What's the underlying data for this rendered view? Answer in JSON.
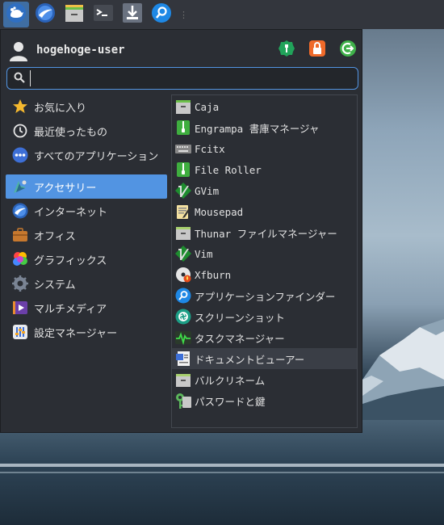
{
  "colors": {
    "accent": "#5294e2",
    "panel": "#33363d",
    "menu_bg": "#2b2e34"
  },
  "panel": {
    "items": [
      {
        "icon": "xfce-mouse-icon",
        "active": true
      },
      {
        "icon": "web-browser-icon"
      },
      {
        "icon": "file-manager-icon"
      },
      {
        "icon": "terminal-icon"
      },
      {
        "icon": "downloads-icon"
      },
      {
        "icon": "app-finder-icon"
      }
    ]
  },
  "menu": {
    "username": "hogehoge-user",
    "search": {
      "value": "",
      "placeholder": ""
    },
    "actions": [
      "settings-icon",
      "lock-screen-icon",
      "log-out-icon"
    ],
    "categories_top": [
      {
        "label": "お気に入り",
        "icon": "star-icon"
      },
      {
        "label": "最近使ったもの",
        "icon": "clock-icon"
      },
      {
        "label": "すべてのアプリケーション",
        "icon": "all-apps-icon"
      }
    ],
    "categories": [
      {
        "label": "アクセサリー",
        "icon": "accessories-icon",
        "selected": true
      },
      {
        "label": "インターネット",
        "icon": "internet-icon"
      },
      {
        "label": "オフィス",
        "icon": "office-icon"
      },
      {
        "label": "グラフィックス",
        "icon": "graphics-icon"
      },
      {
        "label": "システム",
        "icon": "system-icon"
      },
      {
        "label": "マルチメディア",
        "icon": "multimedia-icon"
      },
      {
        "label": "設定マネージャー",
        "icon": "settings-manager-icon"
      }
    ],
    "apps": [
      {
        "label": "Caja",
        "icon": "caja-icon"
      },
      {
        "label": "Engrampa 書庫マネージャ",
        "icon": "archive-icon"
      },
      {
        "label": "Fcitx",
        "icon": "keyboard-icon"
      },
      {
        "label": "File Roller",
        "icon": "archive-icon"
      },
      {
        "label": "GVim",
        "icon": "vim-icon"
      },
      {
        "label": "Mousepad",
        "icon": "text-editor-icon"
      },
      {
        "label": "Thunar ファイルマネージャー",
        "icon": "folder-icon"
      },
      {
        "label": "Vim",
        "icon": "vim-icon"
      },
      {
        "label": "Xfburn",
        "icon": "disc-burner-icon"
      },
      {
        "label": "アプリケーションファインダー",
        "icon": "app-finder-icon"
      },
      {
        "label": "スクリーンショット",
        "icon": "screenshot-icon"
      },
      {
        "label": "タスクマネージャー",
        "icon": "task-manager-icon"
      },
      {
        "label": "ドキュメントビューアー",
        "icon": "document-viewer-icon",
        "hover": true
      },
      {
        "label": "バルクリネーム",
        "icon": "folder-icon"
      },
      {
        "label": "パスワードと鍵",
        "icon": "passwords-keys-icon"
      }
    ]
  }
}
